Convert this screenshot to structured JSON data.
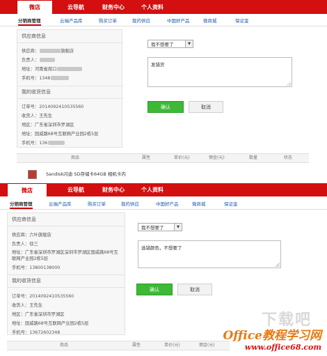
{
  "panel_a": {
    "tabs": [
      "微店",
      "云导航",
      "财务中心",
      "个人资料"
    ],
    "subnav": [
      "分销商管理",
      "云端产品库",
      "购买订单",
      "我的供应",
      "中国好产品",
      "微商城",
      "保证金"
    ],
    "supplier": {
      "title": "供应商信息",
      "store_label": "供应商：",
      "store_suffix": "旗舰店",
      "contact_label": "负责人：",
      "address_label": "地址：",
      "address_value": "河南省周口",
      "phone_label": "手机号：",
      "phone_value": "1348"
    },
    "shipping": {
      "title": "我的收货信息",
      "order_label": "订单号：",
      "order_value": "2014092410535560",
      "receiver_label": "收货人：",
      "receiver_value": "王先生",
      "region_label": "地区：",
      "region_value": "广东省深圳市罗湖区",
      "address_label": "地址：",
      "address_value": "国威路68号互联网产业园2栋5层",
      "phone_label": "手机号：",
      "phone_value": "136"
    },
    "reason_select": "我不想要了",
    "note_text": "发错货",
    "confirm_label": "确认",
    "cancel_label": "取消",
    "table_headers": [
      "商品",
      "属性",
      "单价(元)",
      "佣金(元)",
      "数量",
      "状态"
    ],
    "product_name": "Sandisk闪迪 SD存储卡64GB 相机卡内"
  },
  "panel_b": {
    "tabs": [
      "微店",
      "云导航",
      "财务中心",
      "个人资料"
    ],
    "subnav": [
      "分销商管理",
      "云端产品库",
      "购买订单",
      "我的供应",
      "中国好产品",
      "微商城",
      "保证金"
    ],
    "supplier": {
      "title": "供应商信息",
      "store_text": "供应商：六叶旗舰店",
      "contact_text": "负责人：徐三",
      "address_text": "地址：广东省深圳市罗湖区深圳市罗湖区国威路68号互联网产业园2栋5层",
      "phone_text": "手机号：13800138000"
    },
    "shipping": {
      "title": "我的收货信息",
      "order_text": "订单号：2014092410535560",
      "receiver_text": "收货人：王先生",
      "region_text": "地区：广东省深圳市罗湖区",
      "address_text": "地址：国威路68号互联网产业园2栋5层",
      "phone_text": "手机号：13672602348"
    },
    "reason_select": "我不想要了",
    "note_text": "选错颜色，不想要了",
    "confirm_label": "确认",
    "cancel_label": "取消",
    "table_headers": [
      "商品",
      "属性",
      "单价(元)",
      "佣金(元)"
    ]
  },
  "watermark": {
    "title": "Office教程学习网",
    "url": "www.office68.com"
  }
}
